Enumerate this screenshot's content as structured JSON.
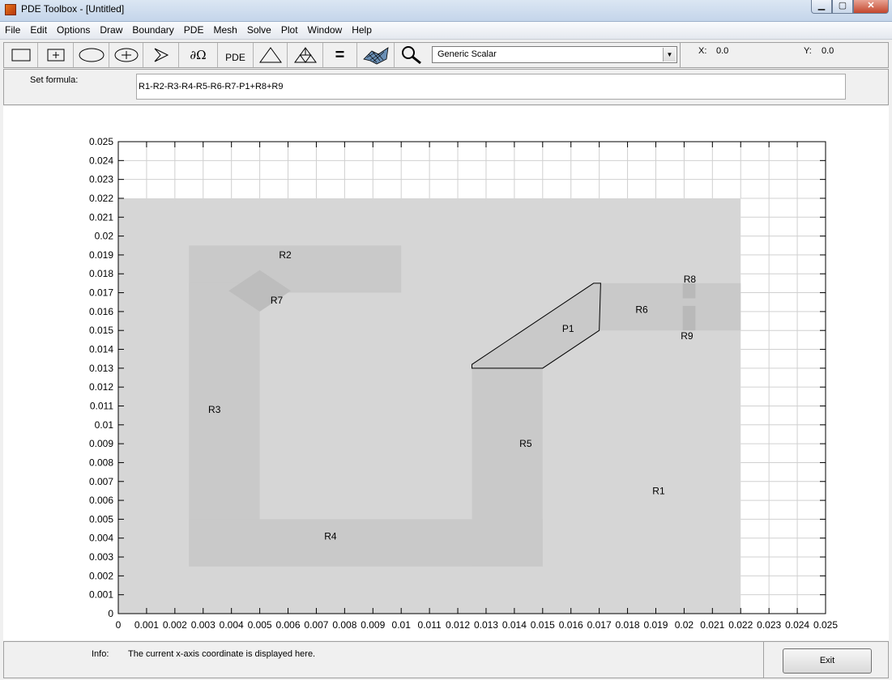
{
  "window": {
    "title": "PDE Toolbox - [Untitled]"
  },
  "menu": [
    "File",
    "Edit",
    "Options",
    "Draw",
    "Boundary",
    "PDE",
    "Mesh",
    "Solve",
    "Plot",
    "Window",
    "Help"
  ],
  "toolbar": {
    "buttons": [
      {
        "name": "draw-rectangle-button",
        "icon": "rectangle-icon"
      },
      {
        "name": "draw-centered-rectangle-button",
        "icon": "centered-rectangle-icon"
      },
      {
        "name": "draw-ellipse-button",
        "icon": "ellipse-icon"
      },
      {
        "name": "draw-centered-ellipse-button",
        "icon": "centered-ellipse-icon"
      },
      {
        "name": "draw-polygon-button",
        "icon": "polygon-icon"
      },
      {
        "name": "boundary-mode-button",
        "label": "∂Ω"
      },
      {
        "name": "pde-spec-button",
        "label": "PDE"
      },
      {
        "name": "init-mesh-button",
        "icon": "triangle-icon"
      },
      {
        "name": "refine-mesh-button",
        "icon": "refine-mesh-icon"
      },
      {
        "name": "solve-button",
        "label": "="
      },
      {
        "name": "plot-button",
        "icon": "surface-plot-icon"
      },
      {
        "name": "zoom-button",
        "icon": "zoom-icon"
      }
    ],
    "application_mode": "Generic Scalar",
    "x_label": "X:",
    "x_value": "0.0",
    "y_label": "Y:",
    "y_value": "0.0"
  },
  "formula": {
    "label": "Set formula:",
    "value": "R1-R2-R3-R4-R5-R6-R7-P1+R8+R9"
  },
  "plot": {
    "xticks": [
      "0",
      "0.001",
      "0.002",
      "0.003",
      "0.004",
      "0.005",
      "0.006",
      "0.007",
      "0.008",
      "0.009",
      "0.01",
      "0.011",
      "0.012",
      "0.013",
      "0.014",
      "0.015",
      "0.016",
      "0.017",
      "0.018",
      "0.019",
      "0.02",
      "0.021",
      "0.022",
      "0.023",
      "0.024",
      "0.025"
    ],
    "yticks": [
      "0",
      "0.001",
      "0.002",
      "0.003",
      "0.004",
      "0.005",
      "0.006",
      "0.007",
      "0.008",
      "0.009",
      "0.01",
      "0.011",
      "0.012",
      "0.013",
      "0.014",
      "0.015",
      "0.016",
      "0.017",
      "0.018",
      "0.019",
      "0.02",
      "0.021",
      "0.022",
      "0.023",
      "0.024",
      "0.025"
    ],
    "xlim": [
      0,
      0.025
    ],
    "ylim": [
      0,
      0.025
    ],
    "grid": true,
    "shapes": [
      {
        "label": "R1",
        "type": "rect",
        "x1": 0,
        "y1": 0,
        "x2": 0.022,
        "y2": 0.022,
        "fill": "#d6d6d6",
        "lx": 0.0191,
        "ly": 0.0065
      },
      {
        "label": "R2",
        "type": "rect",
        "x1": 0.0025,
        "y1": 0.017,
        "x2": 0.01,
        "y2": 0.0195,
        "fill": "#c9c9c9",
        "lx": 0.0059,
        "ly": 0.019
      },
      {
        "label": "R3",
        "type": "rect",
        "x1": 0.0025,
        "y1": 0.0025,
        "x2": 0.005,
        "y2": 0.0175,
        "fill": "#c9c9c9",
        "lx": 0.0034,
        "ly": 0.0108
      },
      {
        "label": "R4",
        "type": "rect",
        "x1": 0.0025,
        "y1": 0.0025,
        "x2": 0.015,
        "y2": 0.005,
        "fill": "#c9c9c9",
        "lx": 0.0075,
        "ly": 0.0041
      },
      {
        "label": "R5",
        "type": "rect",
        "x1": 0.0125,
        "y1": 0.0025,
        "x2": 0.015,
        "y2": 0.013,
        "fill": "#c9c9c9",
        "lx": 0.0144,
        "ly": 0.009
      },
      {
        "label": "R6",
        "type": "rect",
        "x1": 0.017,
        "y1": 0.015,
        "x2": 0.022,
        "y2": 0.0175,
        "fill": "#c9c9c9",
        "lx": 0.0185,
        "ly": 0.0161
      },
      {
        "label": "R7",
        "type": "diamond",
        "cx": 0.005,
        "cy": 0.0171,
        "rx": 0.0011,
        "ry": 0.0011,
        "fill": "#bdbdbd",
        "lx": 0.0056,
        "ly": 0.0166
      },
      {
        "label": "R8",
        "type": "rect",
        "x1": 0.01995,
        "y1": 0.0167,
        "x2": 0.0204,
        "y2": 0.0175,
        "fill": "#b9b9b9",
        "lx": 0.0202,
        "ly": 0.0177
      },
      {
        "label": "R9",
        "type": "rect",
        "x1": 0.01995,
        "y1": 0.015,
        "x2": 0.0204,
        "y2": 0.0163,
        "fill": "#b9b9b9",
        "lx": 0.0201,
        "ly": 0.0147
      },
      {
        "label": "P1",
        "type": "polygon",
        "points": [
          [
            0.0125,
            0.0132
          ],
          [
            0.0125,
            0.013
          ],
          [
            0.015,
            0.013
          ],
          [
            0.017,
            0.015
          ],
          [
            0.01705,
            0.0175
          ],
          [
            0.0168,
            0.0175
          ]
        ],
        "fill": "#c9c9c9",
        "lx": 0.0159,
        "ly": 0.0151
      }
    ]
  },
  "info": {
    "label": "Info:",
    "text": "The current x-axis coordinate is displayed here."
  },
  "exit_label": "Exit"
}
